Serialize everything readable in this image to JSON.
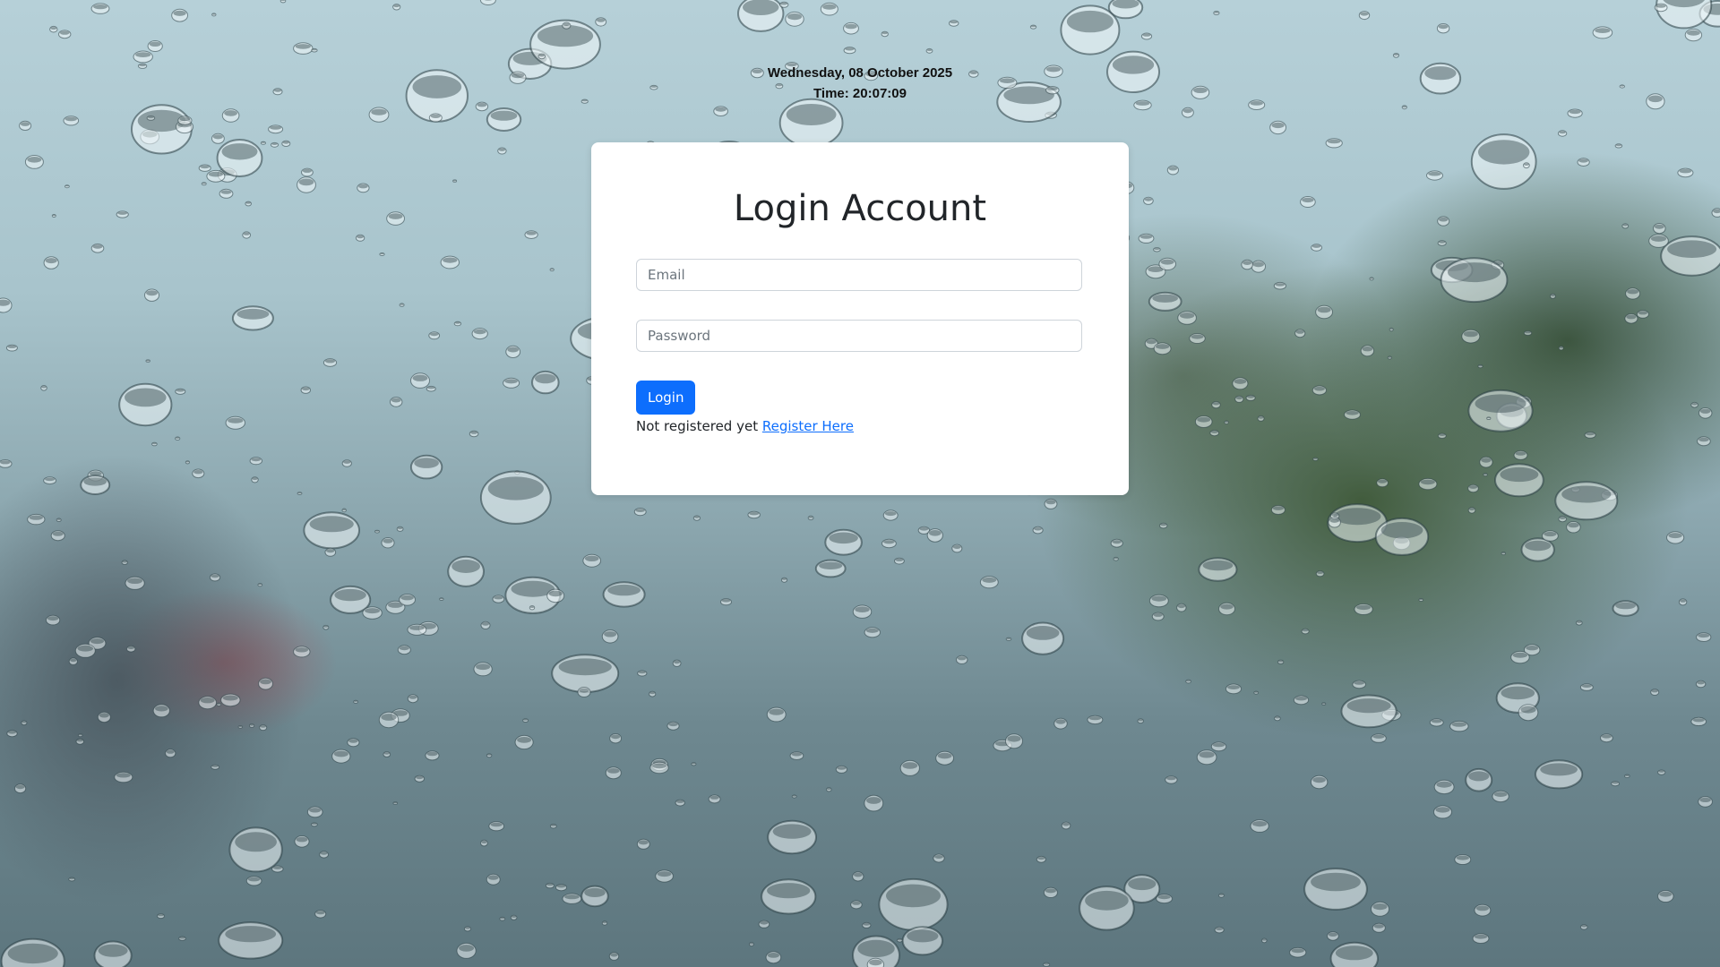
{
  "header": {
    "date": "Wednesday, 08 October 2025",
    "time": "Time: 20:07:09"
  },
  "login_form": {
    "title": "Login Account",
    "email_placeholder": "Email",
    "password_placeholder": "Password",
    "submit_label": "Login",
    "register_prompt": "Not registered yet",
    "register_link": "Register Here"
  },
  "colors": {
    "primary": "#0d6efd",
    "card_background": "#ffffff",
    "text": "#212529"
  }
}
